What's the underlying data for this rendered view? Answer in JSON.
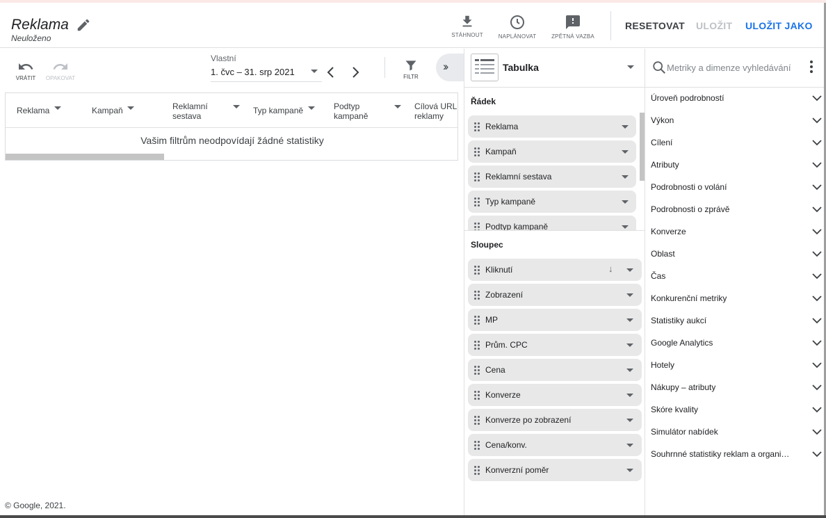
{
  "header": {
    "title": "Reklama",
    "subtitle": "Neuloženo",
    "download_label": "STÁHNOUT",
    "schedule_label": "NAPLÁNOVAT",
    "feedback_label": "ZPĚTNÁ VAZBA",
    "reset_label": "RESETOVAT",
    "save_label": "ULOŽIT",
    "save_as_label": "ULOŽIT JAKO",
    "accent_color": "#1a73e8"
  },
  "toolbar": {
    "undo_label": "VRÁTIT",
    "redo_label": "OPAKOVAT",
    "date_range_label": "Vlastní",
    "date_range_value": "1. čvc – 31. srp 2021",
    "filter_label": "FILTR"
  },
  "table": {
    "columns": [
      "Reklama",
      "Kampaň",
      "Reklamní sestava",
      "Typ kampaně",
      "Podtyp kampaně",
      "Cílová URL reklamy"
    ],
    "empty_message": "Vašim filtrům neodpovídají žádné statistiky"
  },
  "footer": {
    "copyright": "© Google, 2021."
  },
  "editor": {
    "viz_type": "Tabulka",
    "rows_title": "Řádek",
    "rows": [
      "Reklama",
      "Kampaň",
      "Reklamní sestava",
      "Typ kampaně",
      "Podtyp kampaně"
    ],
    "columns_title": "Sloupec",
    "columns": [
      "Kliknutí",
      "Zobrazení",
      "MP",
      "Prům. CPC",
      "Cena",
      "Konverze",
      "Konverze po zobrazení",
      "Cena/konv.",
      "Konverzní poměr"
    ]
  },
  "metrics": {
    "search_placeholder": "Metriky a dimenze vyhledávání",
    "categories": [
      "Úroveň podrobností",
      "Výkon",
      "Cílení",
      "Atributy",
      "Podrobnosti o volání",
      "Podrobnosti o zprávě",
      "Konverze",
      "Oblast",
      "Čas",
      "Konkurenční metriky",
      "Statistiky aukcí",
      "Google Analytics",
      "Hotely",
      "Nákupy – atributy",
      "Skóre kvality",
      "Simulátor nabídek",
      "Souhrnné statistiky reklam a organi…"
    ]
  }
}
